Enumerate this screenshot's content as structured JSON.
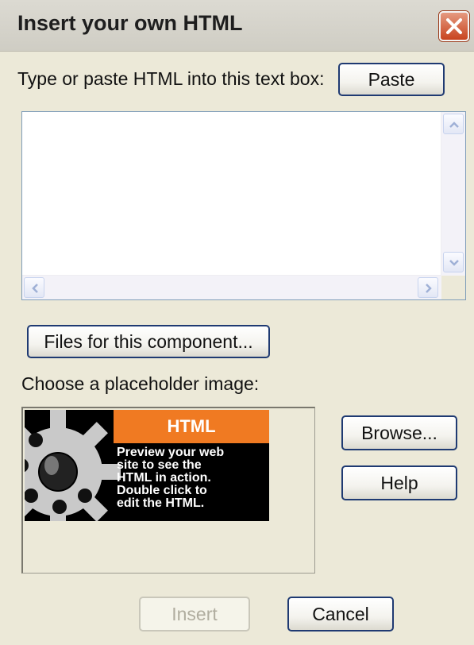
{
  "window": {
    "title": "Insert your own HTML"
  },
  "instructions": {
    "text": "Type or paste HTML into this text box:"
  },
  "buttons": {
    "paste": "Paste",
    "files": "Files for this component...",
    "browse": "Browse...",
    "help": "Help",
    "insert": "Insert",
    "cancel": "Cancel"
  },
  "html_input": {
    "value": ""
  },
  "placeholder_section": {
    "label": "Choose a placeholder image:"
  },
  "placeholder_image": {
    "banner": "HTML",
    "lines": [
      "Preview your web",
      "site to see the",
      "HTML in action.",
      "Double click to",
      "edit the HTML."
    ],
    "colors": {
      "banner": "#f07a22",
      "background": "#000000",
      "gear": "#c9c9c9"
    }
  },
  "state": {
    "insert_enabled": false
  }
}
